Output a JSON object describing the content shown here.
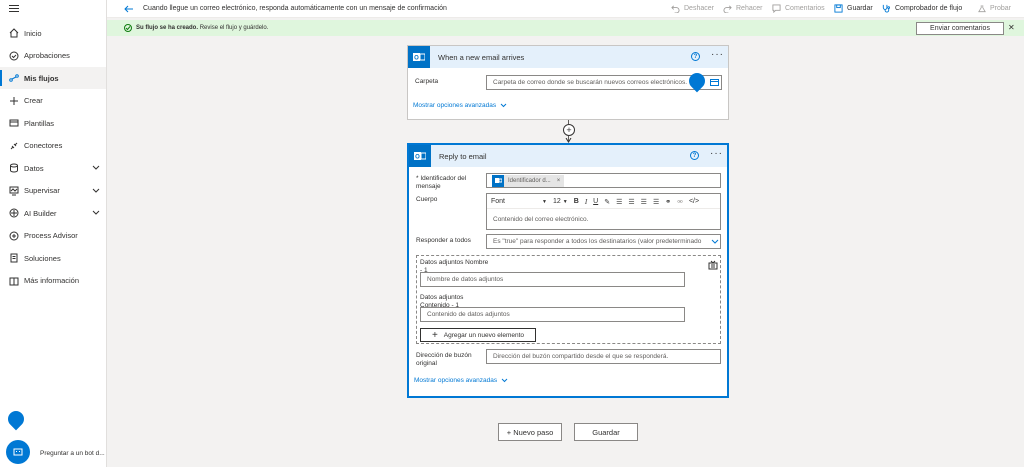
{
  "sidebar": {
    "items": [
      {
        "label": "Inicio",
        "icon": "home-icon"
      },
      {
        "label": "Aprobaciones",
        "icon": "approvals-icon"
      },
      {
        "label": "Mis flujos",
        "icon": "flows-icon",
        "active": true
      },
      {
        "label": "Crear",
        "icon": "plus-icon"
      },
      {
        "label": "Plantillas",
        "icon": "templates-icon"
      },
      {
        "label": "Conectores",
        "icon": "connectors-icon"
      },
      {
        "label": "Datos",
        "icon": "data-icon",
        "expandable": true
      },
      {
        "label": "Supervisar",
        "icon": "monitor-icon",
        "expandable": true
      },
      {
        "label": "AI Builder",
        "icon": "ai-builder-icon",
        "expandable": true
      },
      {
        "label": "Process Advisor",
        "icon": "process-advisor-icon"
      },
      {
        "label": "Soluciones",
        "icon": "solutions-icon"
      },
      {
        "label": "Más información",
        "icon": "learn-icon"
      }
    ],
    "bot_label": "Preguntar a un bot d..."
  },
  "topbar": {
    "title": "Cuando llegue un correo electrónico, responda automáticamente con un mensaje de confirmación",
    "undo": "Deshacer",
    "redo": "Rehacer",
    "comments": "Comentarios",
    "save": "Guardar",
    "checker": "Comprobador de flujo",
    "test": "Probar"
  },
  "notification": {
    "bold": "Su flujo se ha creado.",
    "text": "Revise el flujo y guárdelo.",
    "feedback": "Enviar comentarios"
  },
  "trigger": {
    "title": "When a new email arrives",
    "folder_label": "Carpeta",
    "folder_placeholder": "Carpeta de correo donde se buscarán nuevos correos electrónicos.",
    "advanced": "Mostrar opciones avanzadas"
  },
  "action": {
    "title": "Reply to email",
    "id_label": "* Identificador del mensaje",
    "id_token": "Identificador d...",
    "body_label": "Cuerpo",
    "font": "Font",
    "font_size": "12",
    "body_placeholder": "Contenido del correo electrónico.",
    "reply_all_label": "Responder a todos",
    "reply_all_placeholder": "Es \"true\" para responder a todos los destinatarios (valor predeterminado",
    "att_name_label": "Datos adjuntos Nombre - 1",
    "att_name_placeholder": "Nombre de datos adjuntos",
    "att_content_label": "Datos adjuntos Contenido - 1",
    "att_content_placeholder": "Contenido de datos adjuntos",
    "add_item": "Agregar un nuevo elemento",
    "mailbox_label": "Dirección de buzón original",
    "mailbox_placeholder": "Dirección del buzón compartido desde el que se responderá.",
    "advanced": "Mostrar opciones avanzadas"
  },
  "footer": {
    "new_step": "+ Nuevo paso",
    "save": "Guardar"
  },
  "colors": {
    "accent": "#0078d4",
    "success_bg": "#dff6dd",
    "card_head": "#e4f0fb"
  }
}
